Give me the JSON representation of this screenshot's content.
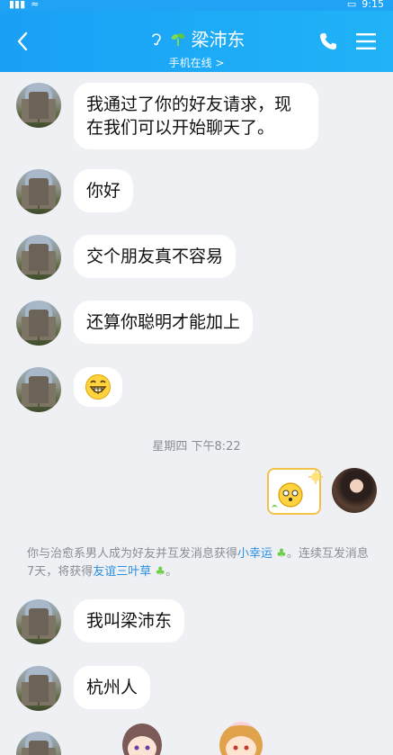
{
  "status_bar": {
    "time": "9:15"
  },
  "header": {
    "contact_name": "梁沛东",
    "status": "手机在线 >"
  },
  "messages": [
    {
      "text": "我通过了你的好友请求，现在我们可以开始聊天了。"
    },
    {
      "text": "你好"
    },
    {
      "text": "交个朋友真不容易"
    },
    {
      "text": "还算你聪明才能加上"
    },
    {
      "text": "😁"
    }
  ],
  "time_separator": "星期四 下午8:22",
  "system_message": {
    "part1": "你与治愈系男人成为好友并互发消息获得",
    "link1": "小幸运",
    "part2": "。连续互发消息7天，将获得",
    "link2": "友谊三叶草",
    "part3": "。"
  },
  "messages_after": [
    {
      "text": "我叫梁沛东"
    },
    {
      "text": "杭州人"
    }
  ],
  "colors": {
    "header": "#1fa8f5",
    "link": "#2a8fe0",
    "sticker_border": "#f2c24a"
  },
  "icons": [
    "back-arrow-icon",
    "ear-icon",
    "sprout-icon",
    "phone-icon",
    "menu-icon",
    "grin-emoji-icon",
    "sun-icon"
  ]
}
